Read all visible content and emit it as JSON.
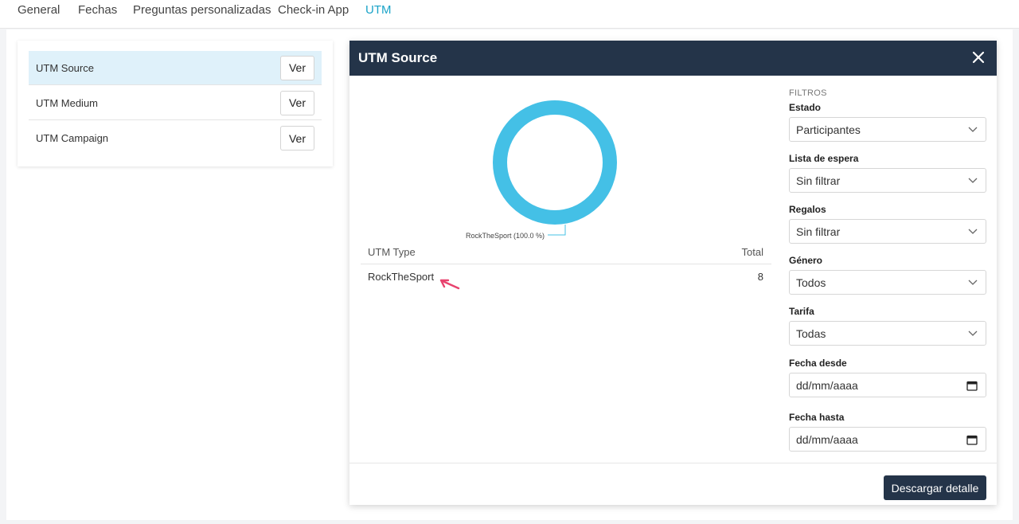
{
  "topnav": {
    "tabs": [
      {
        "label": "General"
      },
      {
        "label": "Fechas"
      },
      {
        "label": "Preguntas personalizadas"
      },
      {
        "label": "Check-in App"
      },
      {
        "label": "UTM"
      }
    ],
    "active_index": 4
  },
  "utm_list": {
    "items": [
      {
        "label": "UTM Source",
        "button": "Ver",
        "selected": true
      },
      {
        "label": "UTM Medium",
        "button": "Ver",
        "selected": false
      },
      {
        "label": "UTM Campaign",
        "button": "Ver",
        "selected": false
      }
    ]
  },
  "modal": {
    "title": "UTM Source",
    "close_icon": "close-icon",
    "chart_data": {
      "type": "pie",
      "categories": [
        "RockTheSport"
      ],
      "values": [
        8
      ],
      "labels": [
        "RockTheSport (100.0 %)"
      ],
      "colors": [
        "#44c0e6"
      ]
    },
    "table": {
      "headers": [
        "UTM Type",
        "Total"
      ],
      "rows": [
        {
          "type": "RockTheSport",
          "total": "8"
        }
      ]
    },
    "filters": {
      "title": "FILTROS",
      "estado": {
        "label": "Estado",
        "value": "Participantes"
      },
      "lista_espera": {
        "label": "Lista de espera",
        "value": "Sin filtrar"
      },
      "regalos": {
        "label": "Regalos",
        "value": "Sin filtrar"
      },
      "genero": {
        "label": "Género",
        "value": "Todos"
      },
      "tarifa": {
        "label": "Tarifa",
        "value": "Todas"
      },
      "fecha_desde": {
        "label": "Fecha desde",
        "placeholder": "dd/mm/aaaa"
      },
      "fecha_hasta": {
        "label": "Fecha hasta",
        "placeholder": "dd/mm/aaaa"
      }
    },
    "footer": {
      "download_label": "Descargar detalle"
    }
  },
  "colors": {
    "accent": "#1aa3c8",
    "header_bg": "#243449",
    "selected_row_bg": "#dff1fa",
    "donut": "#44c0e6",
    "arrow": "#e8436e"
  }
}
